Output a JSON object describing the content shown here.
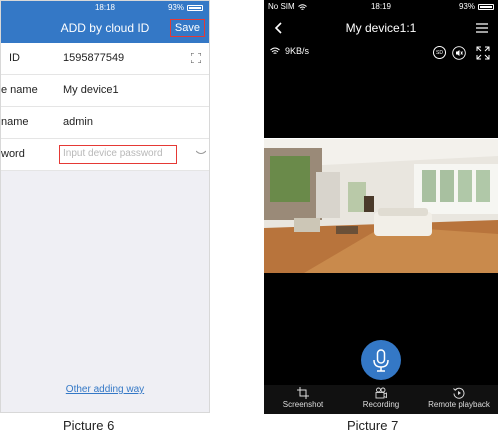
{
  "picture6": {
    "status": {
      "time": "18:18",
      "battery": "93%"
    },
    "nav": {
      "title": "ADD by cloud ID",
      "save_label": "Save"
    },
    "form": {
      "rows": [
        {
          "label": "ID",
          "value": "1595877549"
        },
        {
          "label": "e name",
          "value": "My device1"
        },
        {
          "label": "name",
          "value": "admin"
        },
        {
          "label": "word",
          "placeholder": "Input device password"
        }
      ]
    },
    "other_link": "Other adding way",
    "caption": "Picture 6"
  },
  "picture7": {
    "status": {
      "carrier": "No SIM",
      "time": "18:19",
      "battery": "93%"
    },
    "nav": {
      "title": "My device1:1"
    },
    "toolbar": {
      "speed": "9KB/s",
      "sd_label": "SD"
    },
    "bottom": {
      "screenshot_label": "Screenshot",
      "recording_label": "Recording",
      "playback_label": "Remote playback"
    },
    "caption": "Picture 7"
  },
  "colors": {
    "accent": "#3478c6",
    "highlight": "#e53935"
  }
}
